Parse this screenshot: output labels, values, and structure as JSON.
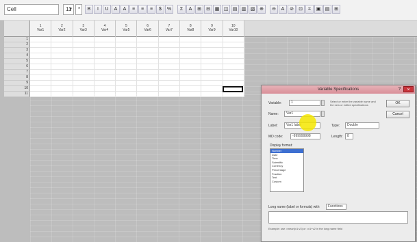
{
  "toolbar": {
    "name_box": "Cell",
    "dropdowns": [
      "11",
      "*"
    ],
    "buttons": [
      "B",
      "I",
      "U",
      "A",
      "A",
      "≡",
      "≡",
      "≡",
      "$",
      "%",
      "Σ",
      "A",
      "⊞",
      "⊟",
      "▦",
      "◫",
      "▤",
      "▥",
      "▧",
      "⊕",
      "⊖",
      "A",
      "⊘",
      "⊡",
      "⌗",
      "▣",
      "▤",
      "⊞"
    ]
  },
  "sheet": {
    "columns": [
      {
        "num": "1",
        "name": "Var1"
      },
      {
        "num": "2",
        "name": "Var2"
      },
      {
        "num": "3",
        "name": "Var3"
      },
      {
        "num": "4",
        "name": "Var4"
      },
      {
        "num": "5",
        "name": "Var5"
      },
      {
        "num": "6",
        "name": "Var6"
      },
      {
        "num": "7",
        "name": "Var7"
      },
      {
        "num": "8",
        "name": "Var8"
      },
      {
        "num": "9",
        "name": "Var9"
      },
      {
        "num": "10",
        "name": "Var10"
      }
    ],
    "rows": [
      "1",
      "2",
      "3",
      "4",
      "5",
      "6",
      "7",
      "8",
      "9",
      "10",
      "11"
    ]
  },
  "dialog": {
    "title": "Variable Specifications",
    "help": "?",
    "close": "×",
    "fields": {
      "var_index_label": "Variable:",
      "var_index_value": "1",
      "name_label": "Name:",
      "name_value": "Var1",
      "label_label": "Label:",
      "label_value": "Var1 label",
      "md_code_label": "MD code:",
      "md_code_value": "-999999998",
      "type_label": "Type:",
      "type_value": "Double",
      "length_label": "Length:",
      "length_value": "8",
      "display_format_label": "Display format:"
    },
    "buttons": {
      "ok": "OK",
      "cancel": "Cancel"
    },
    "formats": [
      "Number",
      "Date",
      "Time",
      "Scientific",
      "Currency",
      "Percentage",
      "Fraction",
      "Text",
      "Custom"
    ],
    "selected_format_index": 0,
    "side_note": "Select or enter the variable name and the new or edited specifications",
    "long_name_label": "Long name (label or formula) with",
    "long_name_option": "Functions",
    "footer": "Example: use =mean(v1:v3) or =v1+v2 in the long name field"
  }
}
